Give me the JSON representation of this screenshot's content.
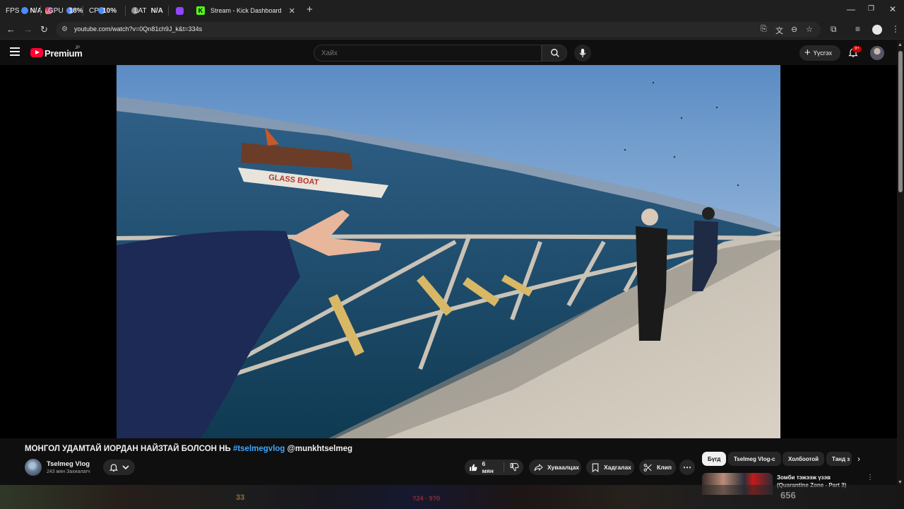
{
  "tabbar": {
    "pinned": [
      {
        "label_left": "FPS",
        "label_right": "N/A",
        "color": "#4a8cff"
      },
      {
        "label_left": "GPU",
        "label_right": "18%",
        "color": "#e1306c"
      },
      {
        "label_left": "CPU",
        "label_right": "10%",
        "color": "#4a8cff"
      },
      {
        "label_left": "LAT",
        "label_right": "N/A",
        "color": "#8f8f8f"
      }
    ],
    "active_tab_title": "Stream - Kick Dashboard",
    "active_tab_icon": "K"
  },
  "address": {
    "url": "youtube.com/watch?v=0Qn81ch9J_k&t=334s"
  },
  "masthead": {
    "brand": "Premium",
    "country": "JP",
    "search_placeholder": "Хайх",
    "create_label": "Үүсгэх",
    "notif_count": "9+"
  },
  "video": {
    "title_main": "МОНГОЛ УДАМТАЙ ИОРДАН НАЙЗТАЙ БОЛСОН НЬ",
    "title_hashtag": "#tselmegvlog",
    "title_mention": "@munkhtselmeg",
    "boat_text": "GLASS BOAT"
  },
  "channel": {
    "name": "Tselmeg Vlog",
    "subscribers": "243 мян Захиалагч"
  },
  "actions": {
    "like_count": "6 мян",
    "share_label": "Хуваалцах",
    "save_label": "Хадгалах",
    "clip_label": "Клип"
  },
  "chips": [
    "Бүгд",
    "Tselmeg Vlog-с",
    "Холбоотой",
    "Танд з"
  ],
  "recommendation": {
    "title": "Зомби тэжээж үзэв (Quarantine Zone - Part 3)"
  },
  "overlay": {
    "numbers": [
      "33",
      "656"
    ],
    "bar_text": "?24 · 9?0"
  },
  "colors": {
    "accent_blue": "#3ea6ff",
    "yt_red": "#ff0033",
    "kick_green": "#53fc18"
  }
}
